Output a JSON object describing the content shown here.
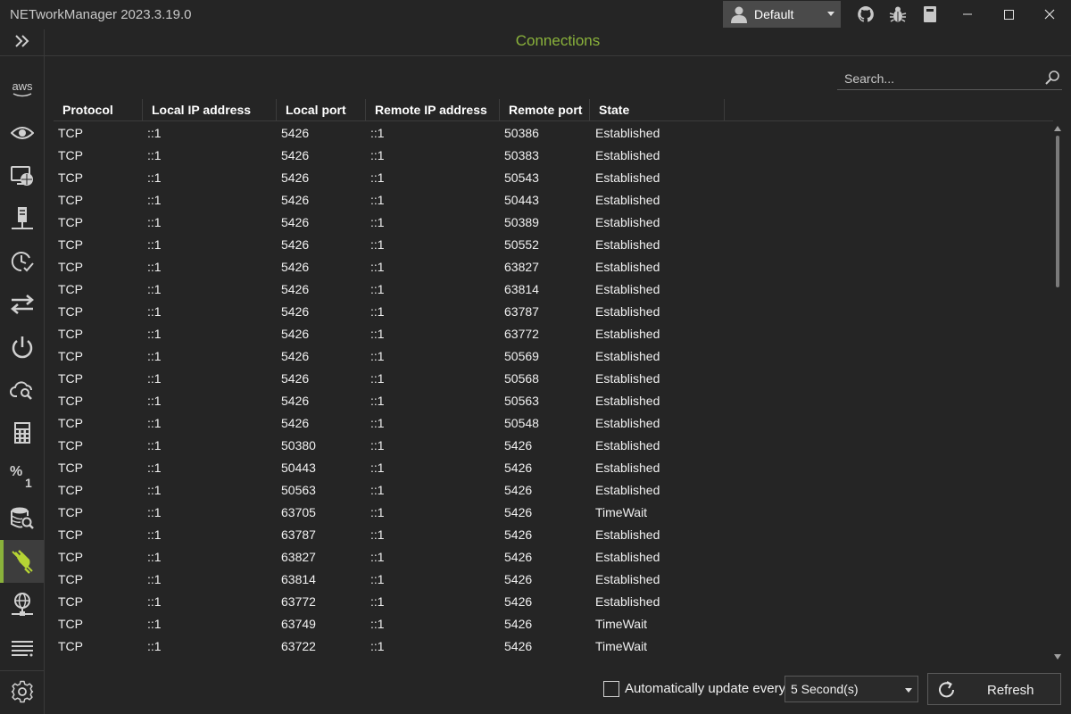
{
  "app": {
    "title": "NETworkManager 2023.3.19.0"
  },
  "profile": {
    "name": "Default"
  },
  "header": {
    "title": "Connections"
  },
  "search": {
    "placeholder": "Search..."
  },
  "sidebar": {
    "items": [
      {
        "id": "expand",
        "icon": "chevrons-right-icon"
      },
      {
        "id": "aws",
        "icon": "aws-icon",
        "text": "aws"
      },
      {
        "id": "network-interface",
        "icon": "eye-icon"
      },
      {
        "id": "ip-scanner",
        "icon": "globe-monitor-icon"
      },
      {
        "id": "port-scanner",
        "icon": "server-icon"
      },
      {
        "id": "ping-monitor",
        "icon": "clock-check-icon"
      },
      {
        "id": "traceroute",
        "icon": "arrows-swap-icon"
      },
      {
        "id": "wake-on-lan",
        "icon": "power-icon"
      },
      {
        "id": "lookup",
        "icon": "cloud-search-icon"
      },
      {
        "id": "calculator",
        "icon": "calculator-icon"
      },
      {
        "id": "subnet",
        "icon": "percent-icon"
      },
      {
        "id": "whois",
        "icon": "database-search-icon"
      },
      {
        "id": "connections",
        "icon": "plug-icon",
        "active": true
      },
      {
        "id": "listeners",
        "icon": "network-globe-icon"
      },
      {
        "id": "arp-table",
        "icon": "list-icon"
      },
      {
        "id": "settings",
        "icon": "gear-icon"
      }
    ]
  },
  "table": {
    "columns": [
      "Protocol",
      "Local IP address",
      "Local port",
      "Remote IP address",
      "Remote port",
      "State"
    ],
    "rows": [
      [
        "TCP",
        "::1",
        "5426",
        "::1",
        "50386",
        "Established"
      ],
      [
        "TCP",
        "::1",
        "5426",
        "::1",
        "50383",
        "Established"
      ],
      [
        "TCP",
        "::1",
        "5426",
        "::1",
        "50543",
        "Established"
      ],
      [
        "TCP",
        "::1",
        "5426",
        "::1",
        "50443",
        "Established"
      ],
      [
        "TCP",
        "::1",
        "5426",
        "::1",
        "50389",
        "Established"
      ],
      [
        "TCP",
        "::1",
        "5426",
        "::1",
        "50552",
        "Established"
      ],
      [
        "TCP",
        "::1",
        "5426",
        "::1",
        "63827",
        "Established"
      ],
      [
        "TCP",
        "::1",
        "5426",
        "::1",
        "63814",
        "Established"
      ],
      [
        "TCP",
        "::1",
        "5426",
        "::1",
        "63787",
        "Established"
      ],
      [
        "TCP",
        "::1",
        "5426",
        "::1",
        "63772",
        "Established"
      ],
      [
        "TCP",
        "::1",
        "5426",
        "::1",
        "50569",
        "Established"
      ],
      [
        "TCP",
        "::1",
        "5426",
        "::1",
        "50568",
        "Established"
      ],
      [
        "TCP",
        "::1",
        "5426",
        "::1",
        "50563",
        "Established"
      ],
      [
        "TCP",
        "::1",
        "5426",
        "::1",
        "50548",
        "Established"
      ],
      [
        "TCP",
        "::1",
        "50380",
        "::1",
        "5426",
        "Established"
      ],
      [
        "TCP",
        "::1",
        "50443",
        "::1",
        "5426",
        "Established"
      ],
      [
        "TCP",
        "::1",
        "50563",
        "::1",
        "5426",
        "Established"
      ],
      [
        "TCP",
        "::1",
        "63705",
        "::1",
        "5426",
        "TimeWait"
      ],
      [
        "TCP",
        "::1",
        "63787",
        "::1",
        "5426",
        "Established"
      ],
      [
        "TCP",
        "::1",
        "63827",
        "::1",
        "5426",
        "Established"
      ],
      [
        "TCP",
        "::1",
        "63814",
        "::1",
        "5426",
        "Established"
      ],
      [
        "TCP",
        "::1",
        "63772",
        "::1",
        "5426",
        "Established"
      ],
      [
        "TCP",
        "::1",
        "63749",
        "::1",
        "5426",
        "TimeWait"
      ],
      [
        "TCP",
        "::1",
        "63722",
        "::1",
        "5426",
        "TimeWait"
      ]
    ]
  },
  "footer": {
    "auto_update_label": "Automatically update every",
    "auto_update_checked": false,
    "interval": "5 Second(s)",
    "refresh_label": "Refresh"
  },
  "colors": {
    "accent": "#8ab23b",
    "background": "#252525"
  }
}
